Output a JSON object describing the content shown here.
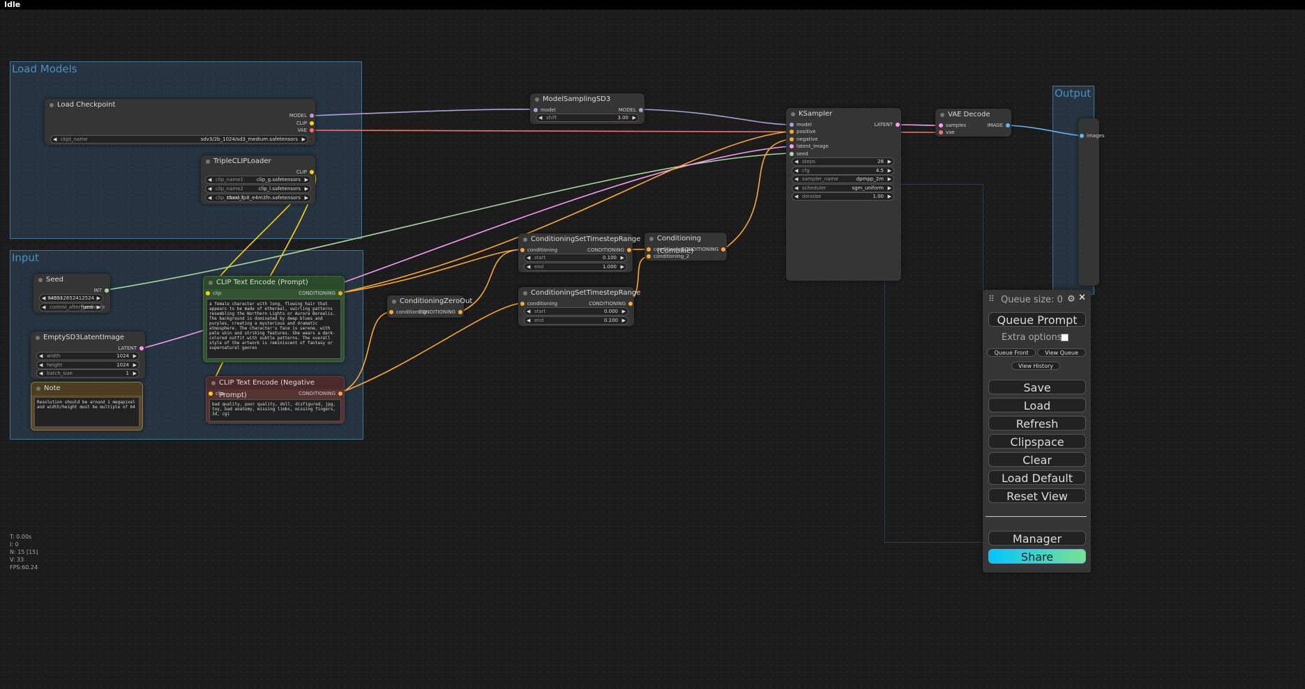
{
  "status": {
    "title": "Idle"
  },
  "groups": {
    "load_models": "Load Models",
    "input": "Input",
    "output": "Output"
  },
  "nodes": {
    "load_checkpoint": {
      "title": "Load Checkpoint",
      "outputs": [
        "MODEL",
        "CLIP",
        "VAE"
      ],
      "ckpt_label": "ckpt_name",
      "ckpt_value": "sdv3/2b_1024/sd3_medium.safetensors"
    },
    "triple_clip": {
      "title": "TripleCLIPLoader",
      "output": "CLIP",
      "widgets": [
        {
          "label": "clip_name1",
          "value": "clip_g.safetensors"
        },
        {
          "label": "clip_name2",
          "value": "clip_l.safetensors"
        },
        {
          "label": "clip_name3",
          "value": "t5xxl_fp8_e4m3fn.safetensors"
        }
      ]
    },
    "model_sampling": {
      "title": "ModelSamplingSD3",
      "input": "model",
      "output": "MODEL",
      "shift_label": "shift",
      "shift_value": "3.00"
    },
    "ksampler": {
      "title": "KSampler",
      "inputs": [
        "model",
        "positive",
        "negative",
        "latent_image",
        "seed"
      ],
      "output": "LATENT",
      "widgets": [
        {
          "label": "steps",
          "value": "28"
        },
        {
          "label": "cfg",
          "value": "4.5"
        },
        {
          "label": "sampler_name",
          "value": "dpmpp_2m"
        },
        {
          "label": "scheduler",
          "value": "sgm_uniform"
        },
        {
          "label": "denoise",
          "value": "1.00"
        }
      ]
    },
    "vae_decode": {
      "title": "VAE Decode",
      "inputs": [
        "samples",
        "vae"
      ],
      "output": "IMAGE"
    },
    "seed": {
      "title": "Seed",
      "output": "INT",
      "value_label": "value",
      "value": "845512652412524",
      "control_label": "control_after_generate",
      "control_value": "fixed"
    },
    "clip_pos": {
      "title": "CLIP Text Encode (Prompt)",
      "input": "clip",
      "output": "CONDITIONING",
      "text": "a female character with long, flowing hair that appears to be made of ethereal, swirling patterns resembling the Northern Lights or Aurora Borealis. The background is dominated by deep blues and purples, creating a mysterious and dramatic atmosphere. The character's face is serene, with pale skin and striking features. She wears a dark-colored outfit with subtle patterns. The overall style of the artwork is reminiscent of fantasy or supernatural genres"
    },
    "clip_neg": {
      "title": "CLIP Text Encode (Negative Prompt)",
      "input": "clip",
      "output": "CONDITIONING",
      "text": "bad quality, poor quality, doll, disfigured, jpg, toy, bad anatomy, missing limbs, missing fingers, 3d, cgi"
    },
    "latent": {
      "title": "EmptySD3LatentImage",
      "output": "LATENT",
      "widgets": [
        {
          "label": "width",
          "value": "1024"
        },
        {
          "label": "height",
          "value": "1024"
        },
        {
          "label": "batch_size",
          "value": "1"
        }
      ]
    },
    "note": {
      "title": "Note",
      "text": "Resolution should be around 1 megapixel and width/height must be multiple of 64"
    },
    "zero_out": {
      "title": "ConditioningZeroOut",
      "input": "conditioning",
      "output": "CONDITIONING"
    },
    "range1": {
      "title": "ConditioningSetTimestepRange",
      "input": "conditioning",
      "output": "CONDITIONING",
      "start_label": "start",
      "start": "0.100",
      "end_label": "end",
      "end": "1.000"
    },
    "range2": {
      "title": "ConditioningSetTimestepRange",
      "input": "conditioning",
      "output": "CONDITIONING",
      "start_label": "start",
      "start": "0.000",
      "end_label": "end",
      "end": "0.100"
    },
    "combine": {
      "title": "Conditioning (Combine)",
      "inputs": [
        "conditioning_1",
        "conditioning_2"
      ],
      "output": "CONDITIONING"
    },
    "output_node": {
      "input": "images"
    }
  },
  "panel": {
    "queue_size": "Queue size: 0",
    "queue_prompt": "Queue Prompt",
    "extra_options": "Extra options",
    "queue_front": "Queue Front",
    "view_queue": "View Queue",
    "view_history": "View History",
    "save": "Save",
    "load": "Load",
    "refresh": "Refresh",
    "clipspace": "Clipspace",
    "clear": "Clear",
    "load_default": "Load Default",
    "reset_view": "Reset View",
    "manager": "Manager",
    "share": "Share",
    "settings_icon": "gear-icon",
    "close_icon": "close-icon",
    "drag_icon": "drag-handle-icon"
  },
  "stats": {
    "t": "T: 0.00s",
    "i": "I: 0",
    "n": "N: 15 [15]",
    "v": "V: 33",
    "fps": "FPS:60.24"
  },
  "colors": {
    "model": "#b39ddb",
    "clip": "#ffd500",
    "vae": "#ff6e6e",
    "conditioning": "#ffa931",
    "latent": "#ff9cf9",
    "int": "#a8d8a0",
    "image": "#64b5f6"
  }
}
